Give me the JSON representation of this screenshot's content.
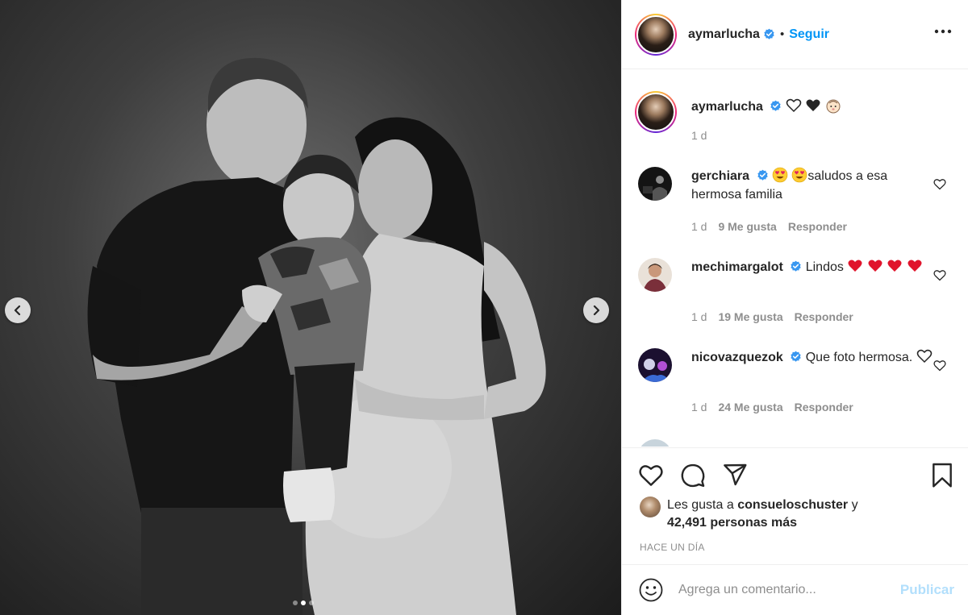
{
  "post": {
    "author": "aymarlucha",
    "follow_label": "Seguir",
    "follow_separator": "•",
    "caption_time": "1 d",
    "caption_emojis": [
      "white-heart",
      "black-heart",
      "baby-face"
    ]
  },
  "carousel": {
    "current_index": 2,
    "total": 3
  },
  "comments": [
    {
      "user": "gerchiara",
      "verified": true,
      "emojis": [
        "heart-eyes",
        "heart-eyes"
      ],
      "text": "saludos a esa hermosa familia",
      "time": "1 d",
      "likes": "9 Me gusta",
      "reply": "Responder"
    },
    {
      "user": "mechimargalot",
      "verified": true,
      "text": "Lindos",
      "emojis": [
        "red-heart",
        "red-heart",
        "red-heart",
        "red-heart"
      ],
      "time": "1 d",
      "likes": "19 Me gusta",
      "reply": "Responder"
    },
    {
      "user": "nicovazquezok",
      "verified": true,
      "text": "Que foto hermosa.",
      "emojis": [
        "white-heart"
      ],
      "time": "1 d",
      "likes": "24 Me gusta",
      "reply": "Responder"
    }
  ],
  "likes": {
    "prefix": "Les gusta a",
    "user": "consueloschuster",
    "joiner": "y",
    "others": "42,491 personas más"
  },
  "timestamp": "HACE UN DÍA",
  "comment_box": {
    "placeholder": "Agrega un comentario...",
    "publish_label": "Publicar"
  },
  "colors": {
    "link": "#0095f6",
    "verified": "#3897f0",
    "publish_disabled": "#b2dffc",
    "muted": "#8e8e8e"
  }
}
